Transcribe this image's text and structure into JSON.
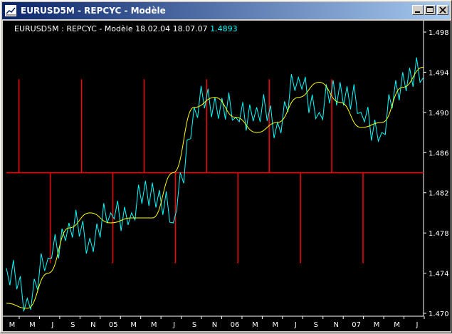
{
  "window": {
    "title": "EURUSD5M - REPCYC - Modèle",
    "minimize_label": "minimize",
    "maximize_label": "maximize",
    "close_label": "close"
  },
  "chart_header": {
    "symbol_indicator": "EURUSD5M : REPCYC - Modèle",
    "date_start": "18.02.04",
    "date_end": "18.07.07",
    "last_price": "1.4893"
  },
  "colors": {
    "background": "#000000",
    "price_line": "#00ffff",
    "cycle_line": "#ffff00",
    "signal_line": "#ff0000",
    "axis": "#ffffff"
  },
  "chart_data": {
    "type": "line",
    "title": "EURUSD5M : REPCYC - Modèle 18.02.04 18.07.07 1.4893",
    "xlabel": "",
    "ylabel": "",
    "ylim": [
      1.47,
      1.498
    ],
    "y_ticks": [
      "1.498",
      "1.494",
      "1.490",
      "1.486",
      "1.482",
      "1.478",
      "1.474",
      "1.470"
    ],
    "x_ticks": [
      "M",
      "M",
      "J",
      "S",
      "N",
      "05",
      "M",
      "M",
      "J",
      "S",
      "N",
      "06",
      "M",
      "M",
      "J",
      "S",
      "N",
      "07",
      "M",
      "M",
      "J"
    ],
    "grid": false,
    "x": [
      0,
      2,
      4,
      6,
      8,
      10,
      12,
      14,
      16,
      18,
      20,
      22,
      24,
      26,
      28,
      30,
      32,
      34,
      36,
      38,
      40
    ],
    "series": [
      {
        "name": "",
        "values": [
          1.4745,
          1.4715,
          1.4755,
          1.479,
          1.4775,
          1.48,
          1.48,
          1.483,
          1.479,
          1.4905,
          1.4915,
          1.4895,
          1.4905,
          1.489,
          1.4935,
          1.49,
          1.493,
          1.49,
          1.488,
          1.494,
          1.4935,
          1.487,
          1.492,
          1.493,
          1.488,
          1.492,
          1.4945,
          1.497,
          1.493,
          1.494,
          1.493,
          1.489,
          1.492,
          1.4895,
          1.491,
          1.492,
          1.49,
          1.49,
          1.495,
          1.492,
          1.4893
        ]
      },
      {
        "name": "",
        "values": [
          1.471,
          1.4705,
          1.474,
          1.4785,
          1.48,
          1.479,
          1.4795,
          1.4795,
          1.484,
          1.4905,
          1.4915,
          1.4895,
          1.488,
          1.489,
          1.4915,
          1.493,
          1.491,
          1.4885,
          1.489,
          1.4925,
          1.4945,
          1.4935,
          1.491,
          1.4895,
          1.4905,
          1.493,
          1.494,
          1.492,
          1.49,
          1.489,
          1.4895,
          1.4915,
          1.4925,
          1.4905,
          1.489,
          1.49,
          1.492,
          1.4935,
          1.494,
          1.4935,
          1.4925
        ]
      }
    ],
    "signal_level": 1.484,
    "signals": [
      {
        "x": 1.2,
        "dir": "up"
      },
      {
        "x": 4.2,
        "dir": "down"
      },
      {
        "x": 7.2,
        "dir": "up"
      },
      {
        "x": 10.2,
        "dir": "down"
      },
      {
        "x": 13.2,
        "dir": "up"
      },
      {
        "x": 16.2,
        "dir": "down"
      },
      {
        "x": 19.2,
        "dir": "up"
      },
      {
        "x": 22.2,
        "dir": "down"
      },
      {
        "x": 25.2,
        "dir": "up"
      },
      {
        "x": 28.2,
        "dir": "down"
      },
      {
        "x": 31.2,
        "dir": "up"
      },
      {
        "x": 34.2,
        "dir": "down"
      }
    ],
    "signal_up_top": 1.4933,
    "signal_down_bottom": 1.475
  }
}
